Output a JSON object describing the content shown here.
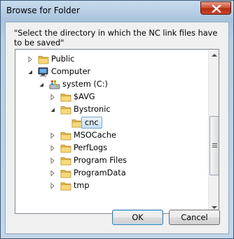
{
  "window": {
    "title": "Browse for Folder"
  },
  "prompt": "\"Select the directory in which the NC link files have to be saved\"",
  "tree": [
    {
      "label": "Public",
      "icon": "folder-icon",
      "arrow": "collapsed",
      "selected": false
    },
    {
      "label": "Computer",
      "icon": "computer-icon",
      "arrow": "expanded",
      "selected": false
    },
    {
      "label": "system (C:)",
      "icon": "drive-icon",
      "arrow": "expanded",
      "selected": false
    },
    {
      "label": "$AVG",
      "icon": "folder-icon",
      "arrow": "collapsed",
      "selected": false
    },
    {
      "label": "Bystronic",
      "icon": "folder-icon",
      "arrow": "expanded",
      "selected": false
    },
    {
      "label": "cnc",
      "icon": "folder-icon",
      "arrow": "none",
      "selected": true
    },
    {
      "label": "MSOCache",
      "icon": "folder-icon",
      "arrow": "collapsed",
      "selected": false
    },
    {
      "label": "PerfLogs",
      "icon": "folder-icon",
      "arrow": "collapsed",
      "selected": false
    },
    {
      "label": "Program Files",
      "icon": "folder-icon",
      "arrow": "collapsed",
      "selected": false
    },
    {
      "label": "ProgramData",
      "icon": "folder-icon",
      "arrow": "collapsed",
      "selected": false
    },
    {
      "label": "tmp",
      "icon": "folder-icon",
      "arrow": "collapsed",
      "selected": false
    }
  ],
  "buttons": {
    "ok": "OK",
    "cancel": "Cancel"
  },
  "colors": {
    "selection_border": "#7da2ce",
    "folder": "#f3d26b",
    "close_button": "#c9482c"
  }
}
